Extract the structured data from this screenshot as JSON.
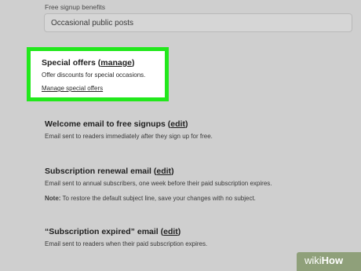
{
  "signup_benefits": {
    "label": "Free signup benefits",
    "value": "Occasional public posts"
  },
  "special_offers": {
    "title": "Special offers",
    "title_link": "manage",
    "description": "Offer discounts for special occasions.",
    "manage_link": "Manage special offers"
  },
  "welcome_email": {
    "title": "Welcome email to free signups",
    "edit_link": "edit",
    "description": "Email sent to readers immediately after they sign up for free."
  },
  "renewal_email": {
    "title": "Subscription renewal email",
    "edit_link": "edit",
    "description": "Email sent to annual subscribers, one week before their paid subscription expires.",
    "note_label": "Note:",
    "note_text": "To restore the default subject line, save your changes with no subject."
  },
  "expired_email": {
    "title": "“Subscription expired” email",
    "edit_link": "edit",
    "description": "Email sent to readers when their paid subscription expires."
  },
  "watermark": {
    "wiki": "wiki",
    "how": "How"
  },
  "colors": {
    "background": "#cfcfcf",
    "highlight_border": "#22e81c",
    "watermark_bg": "#8fa07a"
  }
}
